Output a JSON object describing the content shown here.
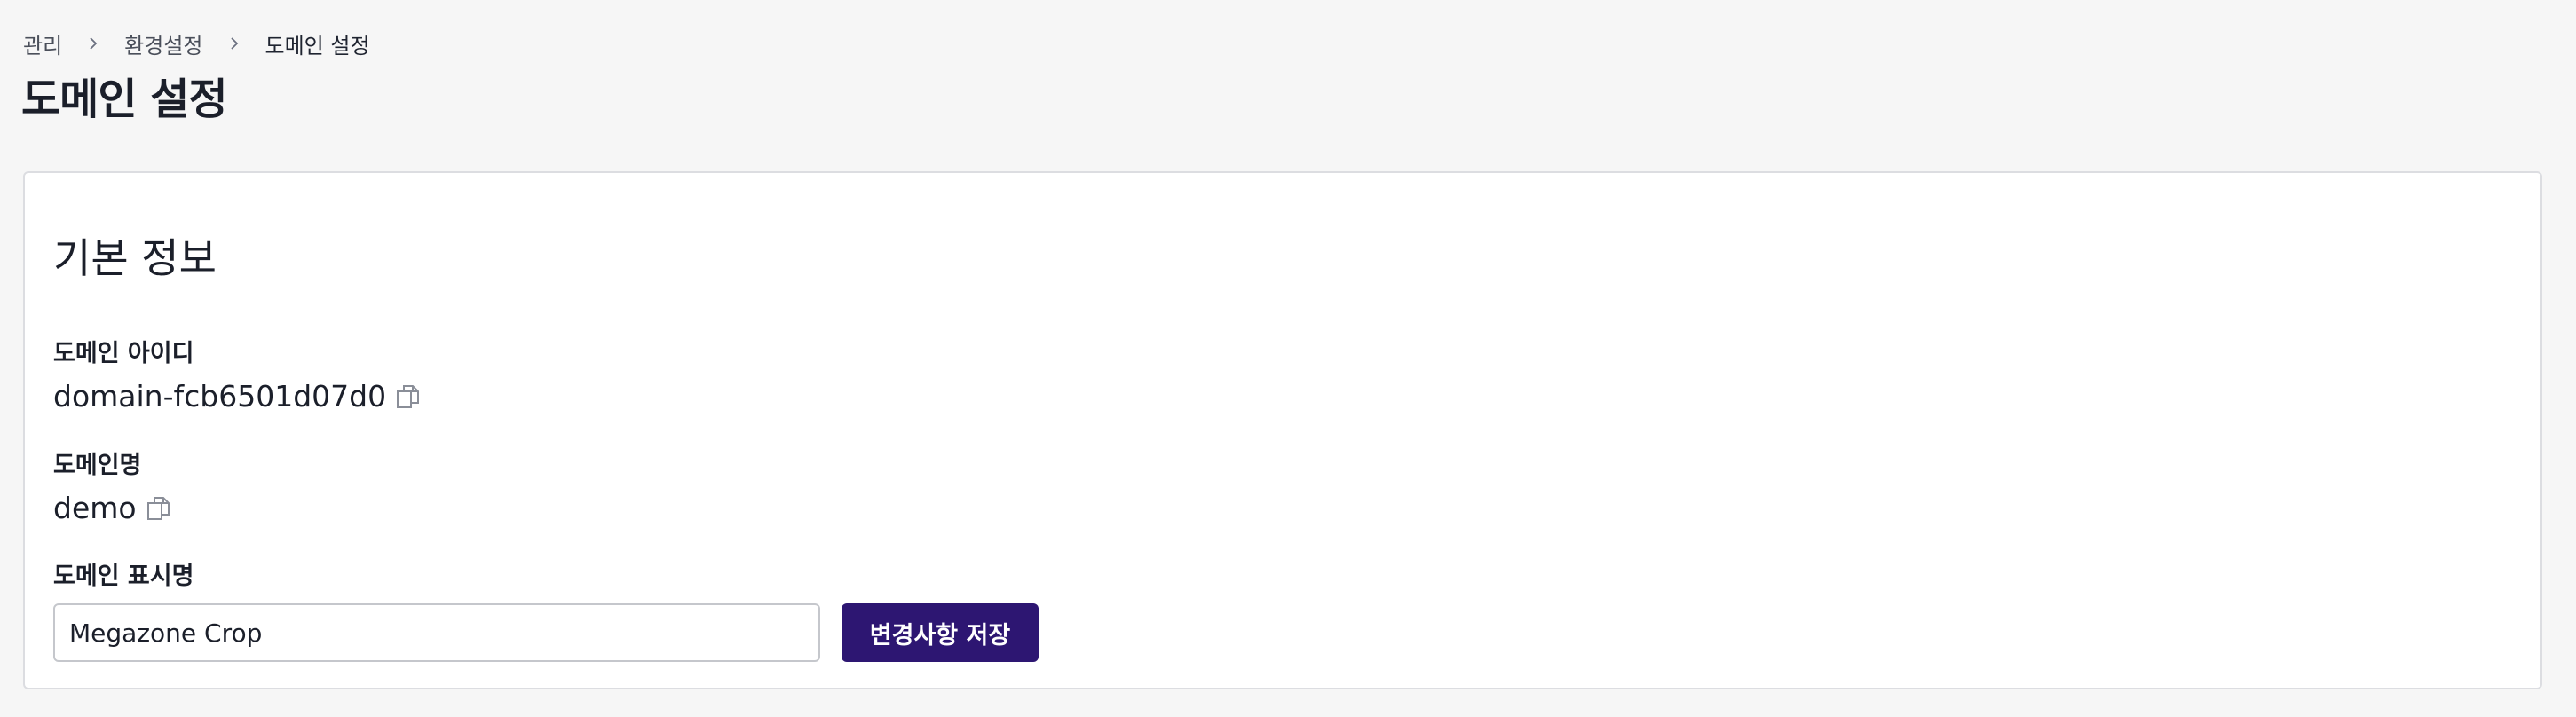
{
  "breadcrumb": {
    "items": [
      {
        "label": "관리"
      },
      {
        "label": "환경설정"
      },
      {
        "label": "도메인 설정"
      }
    ],
    "separator_icon": "chevron-right-icon"
  },
  "page": {
    "title": "도메인 설정"
  },
  "basic_info": {
    "section_title": "기본 정보",
    "domain_id": {
      "label": "도메인 아이디",
      "value": "domain-fcb6501d07d0",
      "copy_icon": "copy-icon"
    },
    "domain_name": {
      "label": "도메인명",
      "value": "demo",
      "copy_icon": "copy-icon"
    },
    "display_name": {
      "label": "도메인 표시명",
      "input_value": "Megazone Crop",
      "save_label": "변경사항 저장"
    }
  },
  "colors": {
    "primary_button": "#2d1672",
    "background": "#f6f6f6",
    "card_border": "#dcdde1"
  }
}
